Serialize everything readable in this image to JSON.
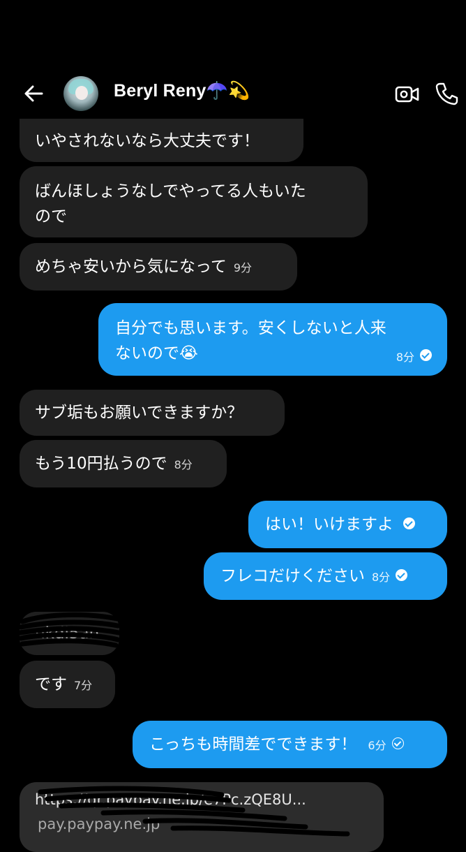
{
  "header": {
    "contact_name": "Beryl Reny☂️💫"
  },
  "messages": [
    {
      "side": "in",
      "text": "いやされないなら大丈夫です！"
    },
    {
      "side": "in",
      "line1": "ばんほしょうなしでやってる人もいた",
      "line2": "ので"
    },
    {
      "side": "in",
      "text": "めちゃ安いから気になって",
      "time": "9分"
    },
    {
      "side": "out",
      "line1": "自分でも思います。安くしないと人来",
      "line2": "ないので😭",
      "time": "8分",
      "status": "sent"
    },
    {
      "side": "in",
      "text": "サブ垢もお願いできますか？"
    },
    {
      "side": "in",
      "text": "もう10円払うので",
      "time": "8分"
    },
    {
      "side": "out",
      "text": "はい！いけますよ",
      "status": "sent"
    },
    {
      "side": "out",
      "text": "フレコだけください",
      "time": "8分",
      "status": "sent"
    },
    {
      "side": "in",
      "text": "nkdl5an",
      "redacted": true
    },
    {
      "side": "in",
      "text": "です",
      "time": "7分"
    },
    {
      "side": "out",
      "text": "こっちも時間差でできます！",
      "time": "6分",
      "status": "delivered"
    },
    {
      "side": "in",
      "line1": "https://qr.paypay.ne.jp/e7Pc.zQE8U...",
      "line2": "pay.paypay.ne.jp",
      "type": "link"
    }
  ],
  "icons": [
    "back-arrow-icon",
    "video-call-icon",
    "phone-icon",
    "check-circle-icon"
  ]
}
